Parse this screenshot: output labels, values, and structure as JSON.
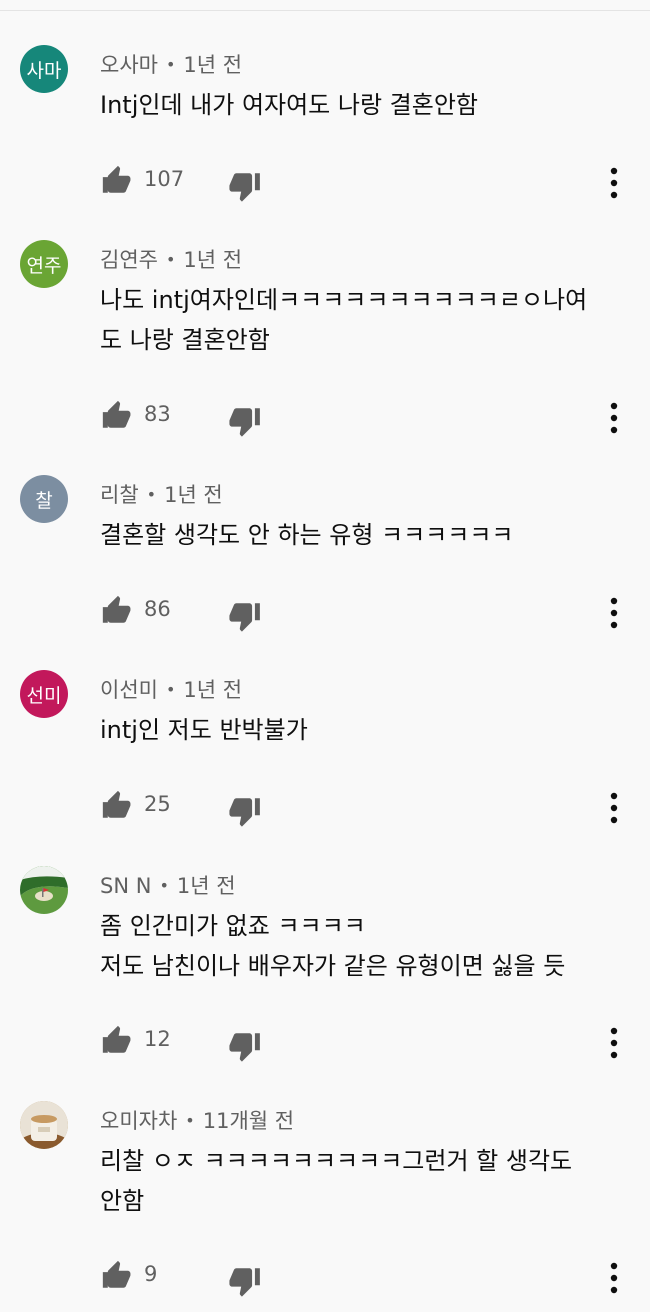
{
  "colors": {
    "background": "#f9f9f9",
    "text_primary": "#0f0f0f",
    "text_secondary": "#606060",
    "icon": "#606060"
  },
  "comments": [
    {
      "avatar_text": "사마",
      "avatar_color": "#16877a",
      "author": "오사마",
      "separator": "•",
      "time": "1년 전",
      "lines": [
        "Intj인데 내가 여자여도 나랑 결혼안함"
      ],
      "likes": "107",
      "icons": [
        "thumb-up-icon",
        "thumb-down-icon",
        "more-vert-icon"
      ]
    },
    {
      "avatar_text": "연주",
      "avatar_color": "#6aa534",
      "author": "김연주",
      "separator": "•",
      "time": "1년 전",
      "lines": [
        "나도 intj여자인데ㅋㅋㅋㅋㅋㅋㅋㅋㅋㅋㄹㅇ나여",
        "도 나랑 결혼안함"
      ],
      "likes": "83",
      "icons": [
        "thumb-up-icon",
        "thumb-down-icon",
        "more-vert-icon"
      ]
    },
    {
      "avatar_text": "찰",
      "avatar_color": "#7c8ea1",
      "author": "리찰",
      "separator": "•",
      "time": "1년 전",
      "lines": [
        "결혼할 생각도 안 하는 유형 ㅋㅋㅋㅋㅋㅋ"
      ],
      "likes": "86",
      "icons": [
        "thumb-up-icon",
        "thumb-down-icon",
        "more-vert-icon"
      ]
    },
    {
      "avatar_text": "선미",
      "avatar_color": "#c2185b",
      "author": "이선미",
      "separator": "•",
      "time": "1년 전",
      "lines": [
        "intj인 저도 반박불가"
      ],
      "likes": "25",
      "icons": [
        "thumb-up-icon",
        "thumb-down-icon",
        "more-vert-icon"
      ]
    },
    {
      "avatar_text": "",
      "avatar_color": "#5c9e4a",
      "avatar_image": "golf-course-photo",
      "author": "SN N",
      "separator": "•",
      "time": "1년 전",
      "lines": [
        "좀 인간미가 없죠 ㅋㅋㅋㅋ",
        "저도 남친이나 배우자가 같은 유형이면 싫을 듯"
      ],
      "likes": "12",
      "icons": [
        "thumb-up-icon",
        "thumb-down-icon",
        "more-vert-icon"
      ]
    },
    {
      "avatar_text": "",
      "avatar_color": "#c9b08a",
      "avatar_image": "cup-photo",
      "author": "오미자차",
      "separator": "•",
      "time": "11개월 전",
      "lines": [
        "리찰 ㅇㅈ ㅋㅋㅋㅋㅋㅋㅋㅋㅋ그런거 할 생각도",
        "안함"
      ],
      "likes": "9",
      "icons": [
        "thumb-up-icon",
        "thumb-down-icon",
        "more-vert-icon"
      ]
    }
  ]
}
